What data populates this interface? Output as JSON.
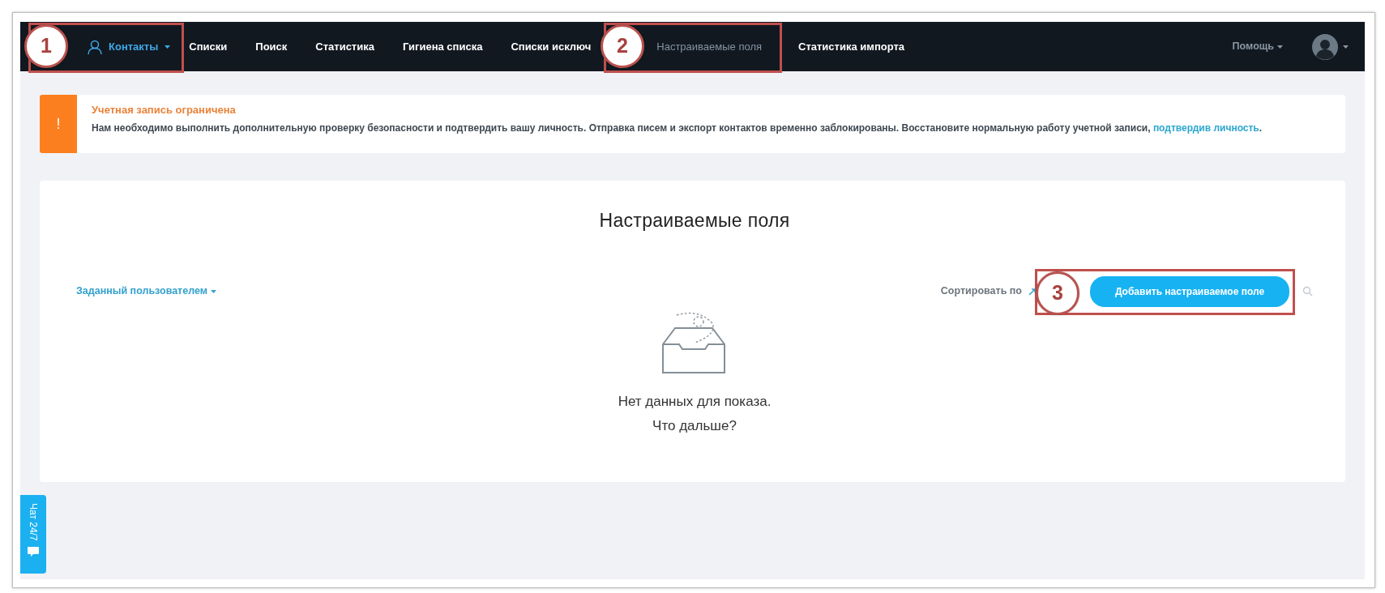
{
  "nav": {
    "items": [
      {
        "label": "Контакты",
        "kind": "dropdown",
        "selected": true,
        "current": false
      },
      {
        "label": "Списки",
        "kind": "link",
        "selected": false,
        "current": false
      },
      {
        "label": "Поиск",
        "kind": "link",
        "selected": false,
        "current": false
      },
      {
        "label": "Статистика",
        "kind": "link",
        "selected": false,
        "current": false
      },
      {
        "label": "Гигиена списка",
        "kind": "link",
        "selected": false,
        "current": false
      },
      {
        "label": "Списки исключ",
        "kind": "link",
        "selected": false,
        "current": false
      },
      {
        "label": "Настраиваемые поля",
        "kind": "link",
        "selected": false,
        "current": true
      },
      {
        "label": "Статистика импорта",
        "kind": "link",
        "selected": false,
        "current": false
      }
    ],
    "help": "Помощь"
  },
  "alert": {
    "icon": "!",
    "title": "Учетная запись ограничена",
    "text": "Нам необходимо выполнить дополнительную проверку безопасности и подтвердить вашу личность. Отправка писем и экспорт контактов временно заблокированы. Восстановите нормальную работу учетной записи,",
    "link": "подтвердив личность",
    "after": "."
  },
  "card": {
    "title": "Настраиваемые поля",
    "filter": "Заданный пользователем",
    "sort_label": "Сортировать по",
    "add_button": "Добавить настраиваемое поле",
    "empty_lines": [
      "Нет данных для показа.",
      "Что дальше?"
    ]
  },
  "chat": {
    "label": "Чат 24/7"
  },
  "annotations": [
    {
      "label": "1"
    },
    {
      "label": "2"
    },
    {
      "label": "3"
    }
  ]
}
